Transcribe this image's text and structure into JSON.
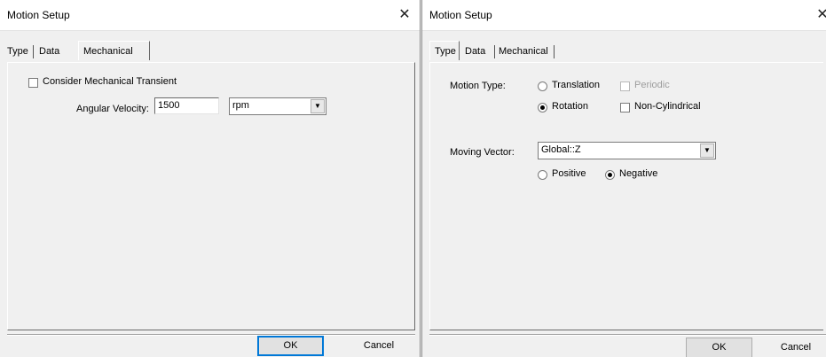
{
  "left_dialog": {
    "title": "Motion Setup",
    "close_glyph": "✕",
    "tabs": [
      "Type",
      "Data",
      "Mechanical"
    ],
    "active_tab": "Mechanical",
    "consider_transient": {
      "label": "Consider Mechanical Transient",
      "checked": false
    },
    "angular_velocity": {
      "label": "Angular Velocity:",
      "value": "1500",
      "unit": "rpm"
    },
    "ok_label": "OK",
    "cancel_label": "Cancel"
  },
  "right_dialog": {
    "title": "Motion Setup",
    "close_glyph": "✕",
    "tabs": [
      "Type",
      "Data",
      "Mechanical"
    ],
    "active_tab": "Type",
    "motion_type": {
      "label": "Motion Type:",
      "translation_label": "Translation",
      "rotation_label": "Rotation",
      "selected": "Rotation",
      "periodic_label": "Periodic",
      "periodic_enabled": false,
      "non_cylindrical_label": "Non-Cylindrical",
      "non_cylindrical_checked": false
    },
    "moving_vector": {
      "label": "Moving Vector:",
      "value": "Global::Z",
      "positive_label": "Positive",
      "negative_label": "Negative",
      "selected": "Negative"
    },
    "ok_label": "OK",
    "cancel_label": "Cancel"
  },
  "icons": {
    "close": "close-icon",
    "dropdown": "chevron-down-icon"
  }
}
